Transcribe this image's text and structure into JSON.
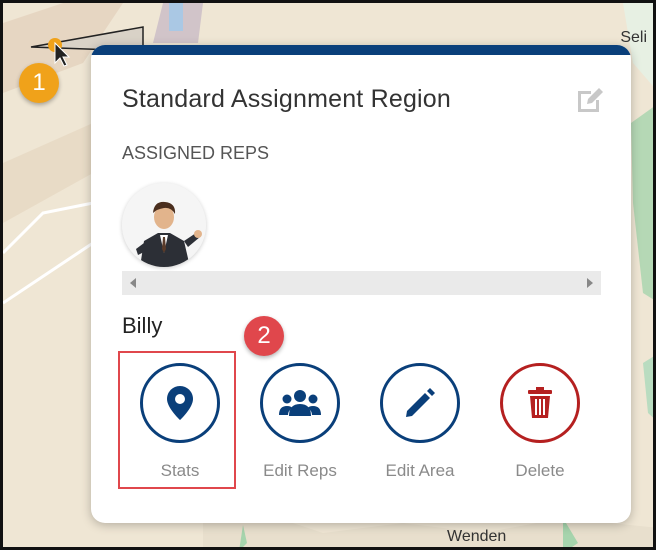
{
  "map": {
    "label_top_right": "Seli",
    "label_bottom": "Wenden"
  },
  "annotations": {
    "badge_1": "1",
    "badge_2": "2"
  },
  "panel": {
    "title": "Standard Assignment Region",
    "assigned_reps_label": "ASSIGNED REPS",
    "rep_name": "Billy",
    "actions": [
      {
        "label": "Stats",
        "icon": "map-pin-icon"
      },
      {
        "label": "Edit Reps",
        "icon": "users-icon"
      },
      {
        "label": "Edit Area",
        "icon": "pencil-icon"
      },
      {
        "label": "Delete",
        "icon": "trash-icon"
      }
    ]
  },
  "colors": {
    "accent": "#0a3f7a",
    "danger": "#b52020",
    "highlight": "#e0474c",
    "badge_orange": "#f0a21a"
  }
}
